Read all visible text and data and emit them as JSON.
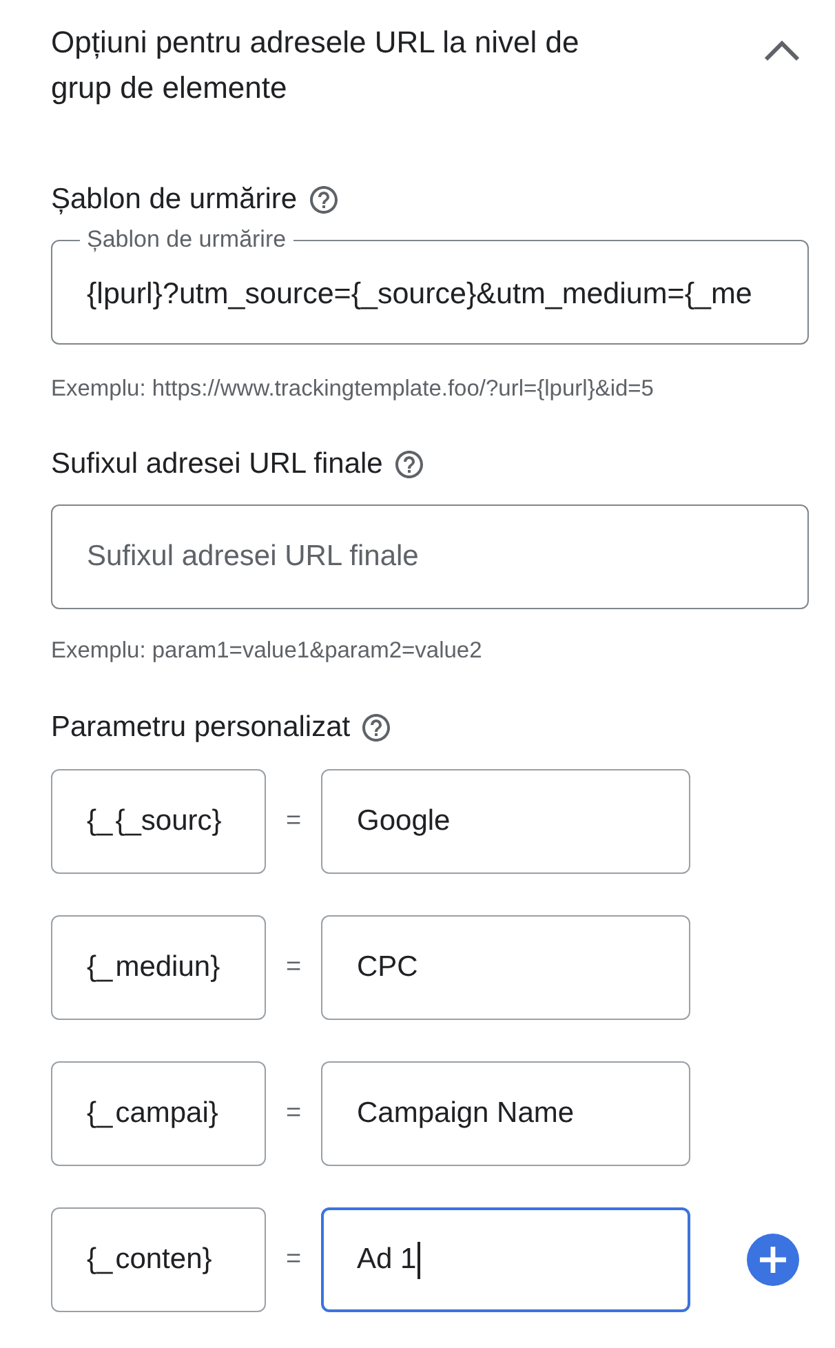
{
  "section": {
    "title": "Opțiuni pentru adresele URL la nivel de grup de elemente",
    "expanded": true
  },
  "tracking_template": {
    "heading": "Șablon de urmărire",
    "field_label": "Șablon de urmărire",
    "value": "{lpurl}?utm_source={_source}&utm_medium={_me",
    "helper": "Exemplu: https://www.trackingtemplate.foo/?url={lpurl}&id=5"
  },
  "final_url_suffix": {
    "heading": "Sufixul adresei URL finale",
    "placeholder": "Sufixul adresei URL finale",
    "helper": "Exemplu: param1=value1&param2=value2"
  },
  "custom_parameters": {
    "heading": "Parametru personalizat",
    "rows": [
      {
        "prefix": "{_",
        "key": "{_sourc",
        "suffix": "}",
        "separator": "=",
        "value": "Google",
        "focused": false
      },
      {
        "prefix": "{_",
        "key": "mediun",
        "suffix": "}",
        "separator": "=",
        "value": "CPC",
        "focused": false
      },
      {
        "prefix": "{_",
        "key": "campai",
        "suffix": "}",
        "separator": "=",
        "value": "Campaign Name",
        "focused": false
      },
      {
        "prefix": "{_",
        "key": "conten",
        "suffix": "}",
        "separator": "=",
        "value": "Ad 1",
        "focused": true
      }
    ]
  }
}
